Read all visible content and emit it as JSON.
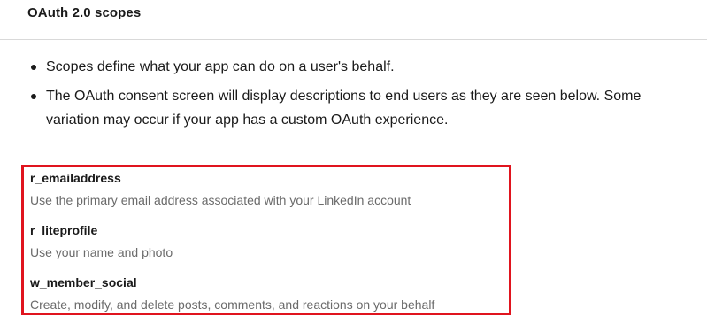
{
  "section": {
    "title": "OAuth 2.0 scopes"
  },
  "bullets": [
    "Scopes define what your app can do on a user's behalf.",
    "The OAuth consent screen will display descriptions to end users as they are seen below. Some variation may occur if your app has a custom OAuth experience."
  ],
  "scopes": [
    {
      "name": "r_emailaddress",
      "description": "Use the primary email address associated with your LinkedIn account"
    },
    {
      "name": "r_liteprofile",
      "description": "Use your name and photo"
    },
    {
      "name": "w_member_social",
      "description": "Create, modify, and delete posts, comments, and reactions on your behalf"
    }
  ],
  "colors": {
    "highlight_border": "#e0141e",
    "description_text": "#6b6b6b",
    "divider": "#d9d9d9"
  }
}
